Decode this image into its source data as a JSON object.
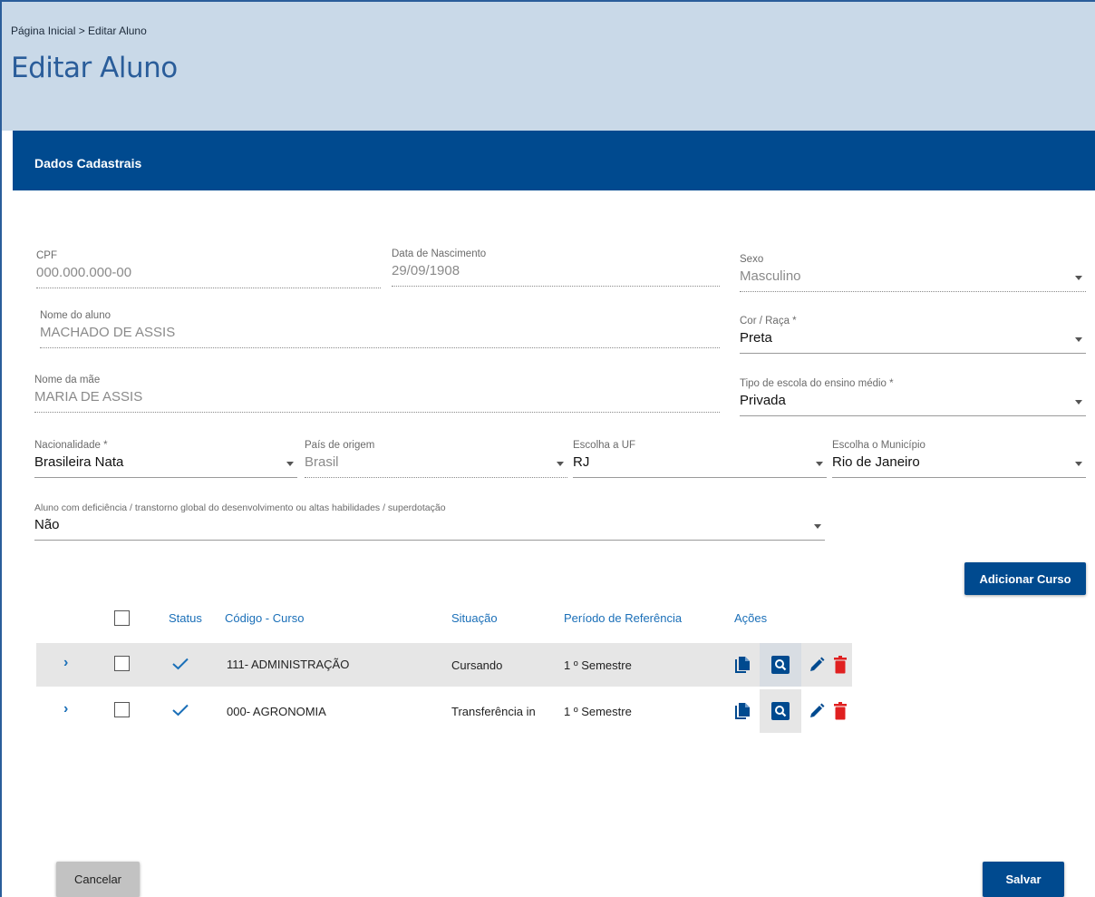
{
  "header": {
    "breadcrumb": "Página Inicial > Editar Aluno",
    "title": "Editar Aluno"
  },
  "section": {
    "title": "Dados Cadastrais"
  },
  "form": {
    "cpf": {
      "label": "CPF",
      "value": "000.000.000-00"
    },
    "birth": {
      "label": "Data de Nascimento",
      "value": "29/09/1908"
    },
    "sex": {
      "label": "Sexo",
      "value": "Masculino"
    },
    "name": {
      "label": "Nome do aluno",
      "value": "MACHADO DE ASSIS"
    },
    "race": {
      "label": "Cor / Raça *",
      "value": "Preta"
    },
    "mother": {
      "label": "Nome da mãe",
      "value": "MARIA DE ASSIS"
    },
    "school": {
      "label": "Tipo de escola do ensino médio *",
      "value": "Privada"
    },
    "nationality": {
      "label": "Nacionalidade *",
      "value": "Brasileira Nata"
    },
    "country": {
      "label": "País de origem",
      "value": "Brasil"
    },
    "uf": {
      "label": "Escolha a UF",
      "value": "RJ"
    },
    "city": {
      "label": "Escolha o Município",
      "value": "Rio de Janeiro"
    },
    "disability": {
      "label": "Aluno com deficiência / transtorno global do desenvolvimento ou altas habilidades / superdotação",
      "value": "Não"
    }
  },
  "buttons": {
    "add_course": "Adicionar Curso",
    "cancel": "Cancelar",
    "save": "Salvar"
  },
  "table": {
    "headers": {
      "status": "Status",
      "course": "Código - Curso",
      "situation": "Situação",
      "period": "Período de Referência",
      "actions": "Ações"
    },
    "rows": [
      {
        "course": "111- ADMINISTRAÇÃO",
        "situation": "Cursando",
        "period": "1 º Semestre"
      },
      {
        "course": "000- AGRONOMIA",
        "situation": "Transferência in",
        "period": "1 º Semestre"
      }
    ]
  },
  "colors": {
    "primary": "#004a8f",
    "header_bg": "#c9d9e8",
    "link": "#1a6fb8",
    "delete": "#e02020"
  }
}
